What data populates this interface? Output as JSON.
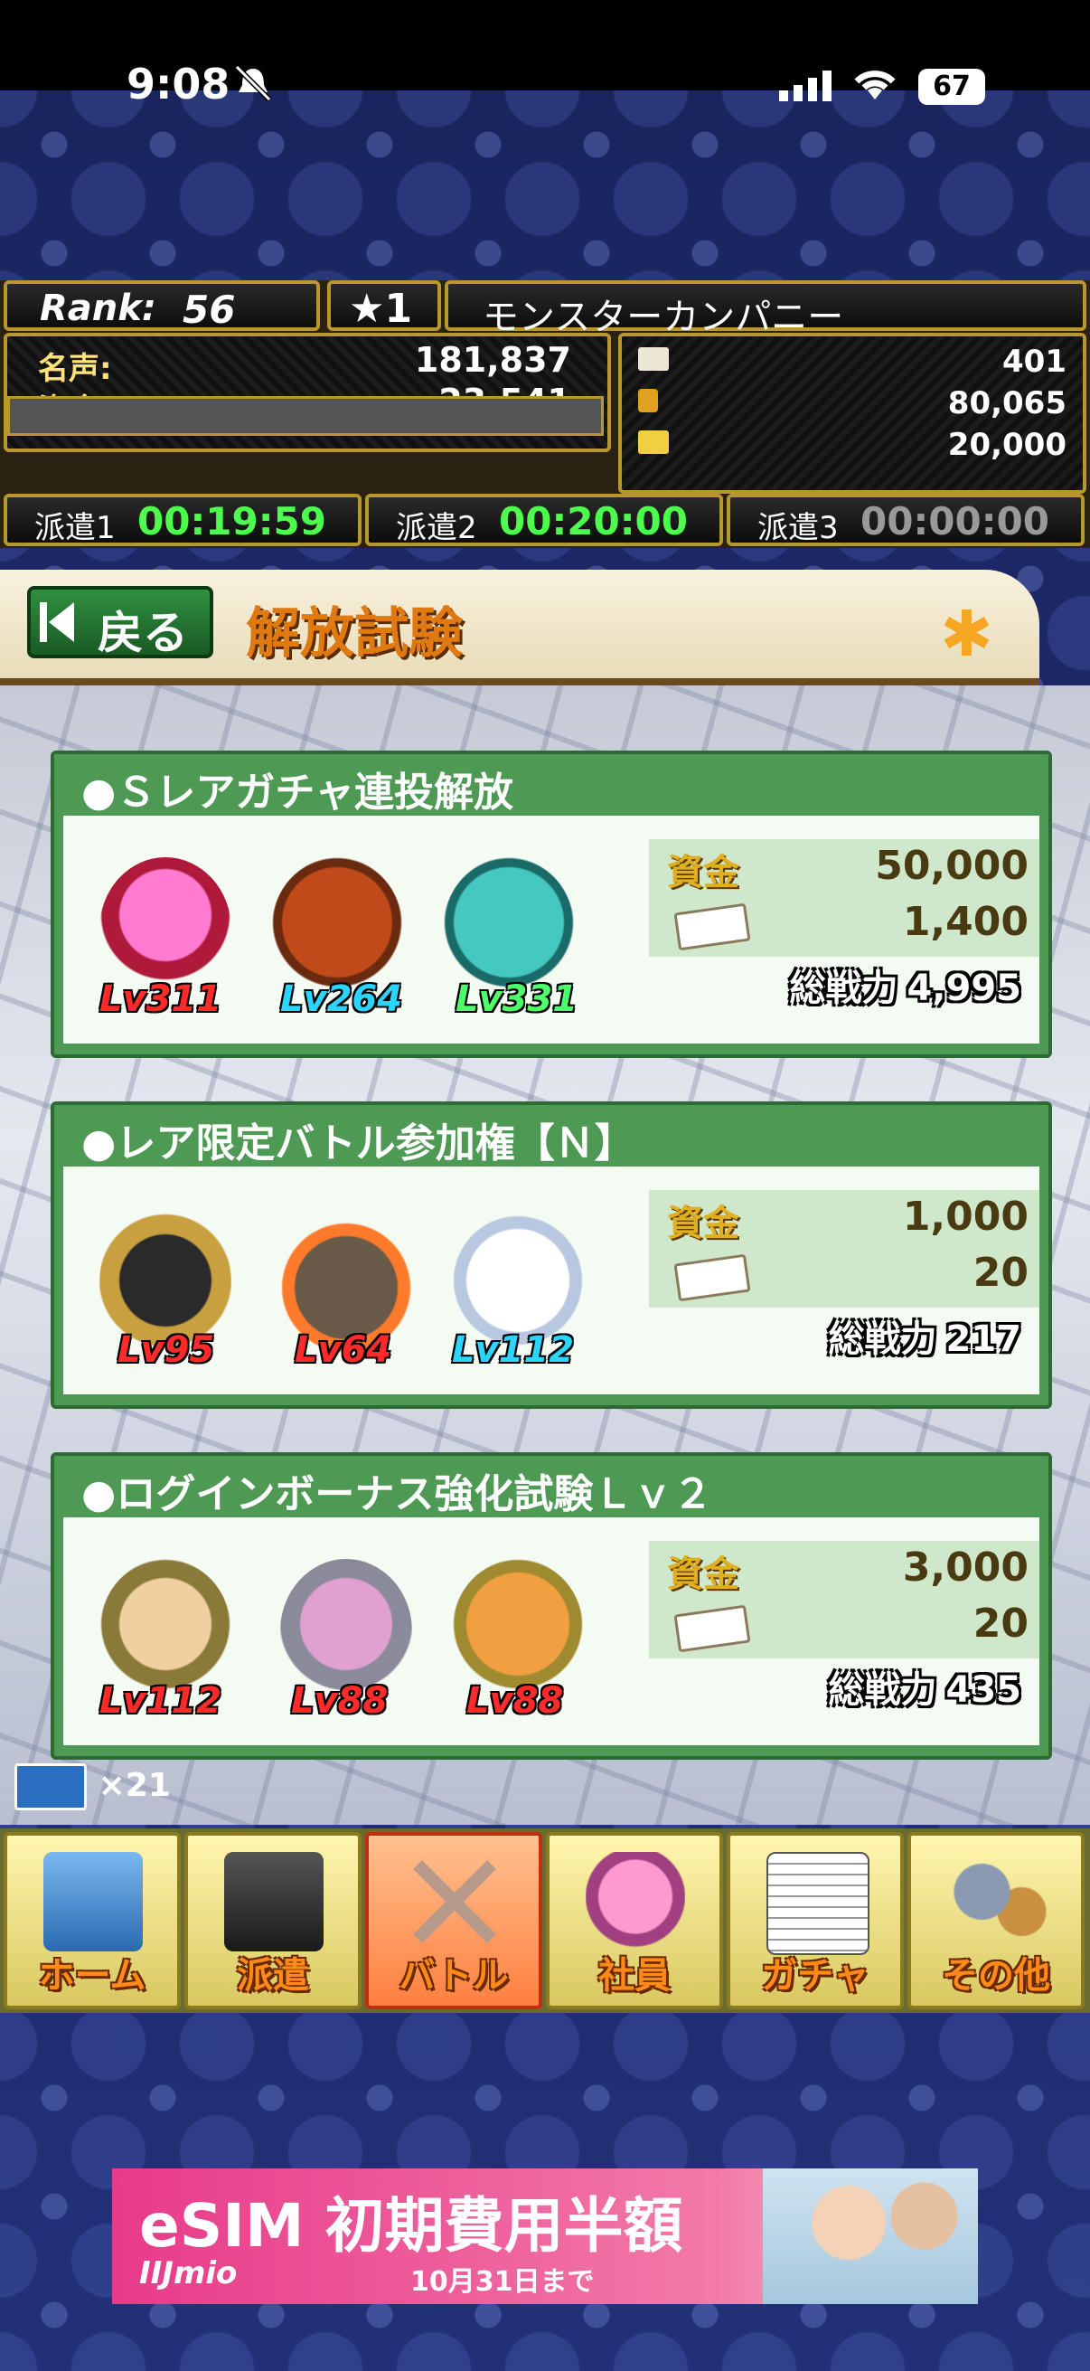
{
  "status_bar": {
    "time": "9:08",
    "battery": "67"
  },
  "header": {
    "rank_label": "Rank:",
    "rank_value": "56",
    "star_rating": "★1",
    "company_name": "モンスターカンパニー",
    "fame_label": "名声:",
    "fame_value": "181,837",
    "funds_label": "資金:",
    "funds_value": "23,541",
    "resources": [
      "401",
      "80,065",
      "20,000"
    ],
    "dispatch": [
      {
        "label": "派遣1",
        "time": "00:19:59"
      },
      {
        "label": "派遣2",
        "time": "00:20:00"
      },
      {
        "label": "派遣3",
        "time": "00:00:00"
      }
    ]
  },
  "title_bar": {
    "back_label": "戻る",
    "page_title": "解放試験"
  },
  "quests": [
    {
      "title": "●Ｓレアガチャ連投解放",
      "monsters": [
        {
          "level": "Lv311",
          "color": "#ff2a2a"
        },
        {
          "level": "Lv264",
          "color": "#2ad6ff"
        },
        {
          "level": "Lv331",
          "color": "#4dff6a"
        }
      ],
      "funds_label": "資金",
      "funds_cost": "50,000",
      "ticket_cost": "1,400",
      "power_label": "総戦力",
      "power_value": "4,995"
    },
    {
      "title": "●レア限定バトル参加権【Ｎ】",
      "monsters": [
        {
          "level": "Lv95",
          "color": "#ff2a2a"
        },
        {
          "level": "Lv64",
          "color": "#ff2a2a"
        },
        {
          "level": "Lv112",
          "color": "#2ad6ff"
        }
      ],
      "funds_label": "資金",
      "funds_cost": "1,000",
      "ticket_cost": "20",
      "power_label": "総戦力",
      "power_value": "217"
    },
    {
      "title": "●ログインボーナス強化試験Ｌｖ２",
      "monsters": [
        {
          "level": "Lv112",
          "color": "#ff2a2a"
        },
        {
          "level": "Lv88",
          "color": "#ff2a2a"
        },
        {
          "level": "Lv88",
          "color": "#ff2a2a"
        }
      ],
      "funds_label": "資金",
      "funds_cost": "3,000",
      "ticket_cost": "20",
      "power_label": "総戦力",
      "power_value": "435"
    }
  ],
  "ticket_count": "×21",
  "nav": [
    {
      "label": "ホーム",
      "icon": "building-icon"
    },
    {
      "label": "派遣",
      "icon": "briefcase-icon"
    },
    {
      "label": "バトル",
      "icon": "crossed-swords-icon",
      "active": true
    },
    {
      "label": "社員",
      "icon": "employee-icon"
    },
    {
      "label": "ガチャ",
      "icon": "document-icon"
    },
    {
      "label": "その他",
      "icon": "gear-trophy-icon"
    }
  ],
  "ad": {
    "headline": "eSIM 初期費用半額",
    "brand": "IIJmio",
    "deadline": "10月31日まで"
  },
  "colors": {
    "card_green": "#4e9a55",
    "dispatch_active": "#4dff4d",
    "dispatch_idle": "#999999",
    "nav_active": "#ff8040",
    "title_orange": "#e07a10"
  }
}
